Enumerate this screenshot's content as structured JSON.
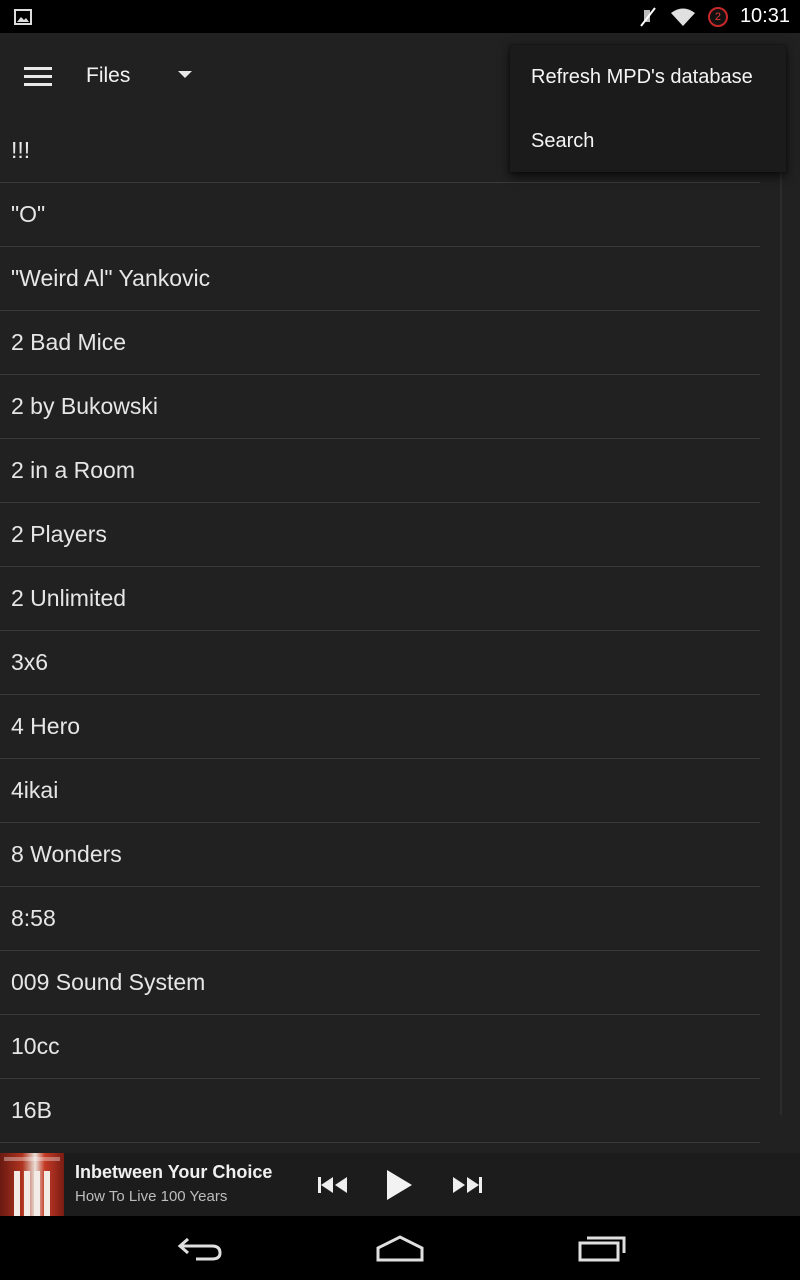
{
  "status_bar": {
    "time": "10:31",
    "notification_count": "2",
    "icons": [
      "image-icon",
      "mute-icon",
      "wifi-icon",
      "notification-badge-icon"
    ]
  },
  "toolbar": {
    "spinner_label": "Files",
    "menu_icon": "hamburger-icon",
    "dropdown_icon": "dropdown-arrow-icon"
  },
  "overflow_menu": {
    "items": [
      {
        "label": "Refresh MPD's database"
      },
      {
        "label": "Search"
      }
    ]
  },
  "list": {
    "items": [
      "!!!",
      "\"O\"",
      "\"Weird Al\" Yankovic",
      "2 Bad Mice",
      "2 by Bukowski",
      "2 in a Room",
      "2 Players",
      "2 Unlimited",
      "3x6",
      "4 Hero",
      "4ikai",
      "8 Wonders",
      "8:58",
      "009 Sound System",
      "10cc",
      "16B"
    ]
  },
  "now_playing": {
    "title": "Inbetween Your Choice",
    "artist": "How To Live 100 Years",
    "controls": [
      "previous-icon",
      "play-icon",
      "next-icon"
    ]
  },
  "nav_bar": {
    "buttons": [
      "back-icon",
      "home-icon",
      "recents-icon"
    ]
  },
  "colors": {
    "background": "#212121",
    "divider": "#3a3a3a",
    "text": "#e6e6e6",
    "menu_background": "#1b1b1b"
  }
}
